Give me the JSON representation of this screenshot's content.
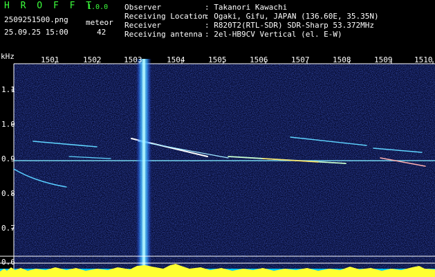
{
  "header": {
    "app_title": "H R O F F T",
    "version": "1.0.0",
    "filename": "2509251500.png",
    "meteor_label": "meteor",
    "timestamp": "25.09.25 15:00",
    "meteor_count": "42",
    "info": [
      {
        "label": "Observer",
        "value": ": Takanori Kawachi"
      },
      {
        "label": "Receiving Location",
        "value": ": Ogaki, Gifu, JAPAN (136.60E, 35.35N)"
      },
      {
        "label": "Receiver",
        "value": ": R820T2(RTL-SDR) SDR-Sharp 53.372MHz"
      },
      {
        "label": "Receiving antenna",
        "value": ": 2el-HB9CV Vertical (el. E-W)"
      }
    ]
  },
  "axes": {
    "y_unit": "kHz",
    "x_ticks": [
      "1501",
      "1502",
      "1503",
      "1504",
      "1505",
      "1506",
      "1507",
      "1508",
      "1509",
      "1510"
    ],
    "y_ticks": [
      "1.1",
      "1.0",
      "0.9",
      "0.8",
      "0.7",
      "0.6"
    ]
  },
  "colors": {
    "background": "#000000",
    "noise": "#1a2aa8",
    "signal": "#4fd8ff",
    "header_green": "#3cff3c",
    "level_yellow": "#ffff33",
    "level_cyan": "#00ccff"
  }
}
